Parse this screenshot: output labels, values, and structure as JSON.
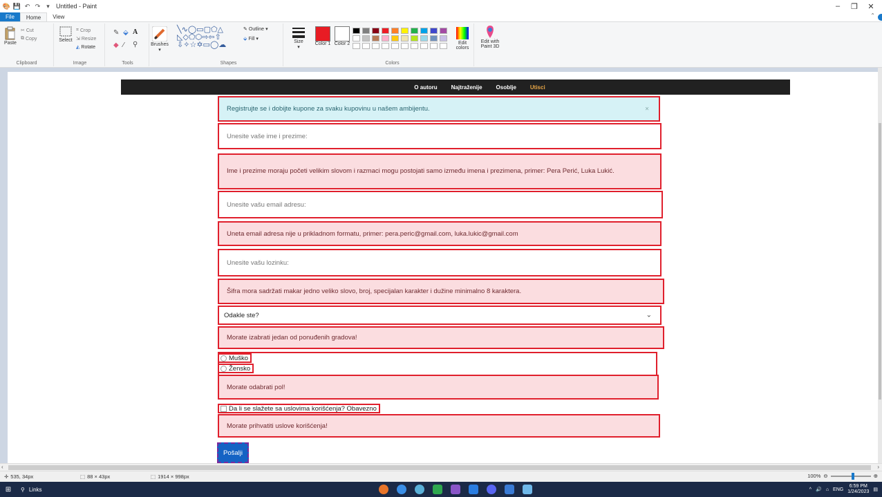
{
  "window": {
    "title": "Untitled - Paint",
    "controls": [
      "–",
      "❐",
      "✕"
    ]
  },
  "tabs": {
    "file": "File",
    "home": "Home",
    "view": "View"
  },
  "ribbon": {
    "clipboard": {
      "paste": "Paste",
      "cut": "Cut",
      "copy": "Copy",
      "label": "Clipboard"
    },
    "image": {
      "select": "Select",
      "crop": "Crop",
      "resize": "Resize",
      "rotate": "Rotate",
      "label": "Image"
    },
    "tools": {
      "label": "Tools"
    },
    "brushes": {
      "label": "Brushes"
    },
    "shapes": {
      "outline": "Outline",
      "fill": "Fill",
      "label": "Shapes"
    },
    "size": {
      "label": "Size"
    },
    "colors": {
      "color1": "Color 1",
      "color2": "Color 2",
      "edit_colors": "Edit colors",
      "edit_paint3d": "Edit with Paint 3D",
      "label": "Colors",
      "color1_value": "#e81c24",
      "color2_value": "#ffffff",
      "palette_row1": [
        "#000000",
        "#7f7f7f",
        "#880015",
        "#ed1c24",
        "#ff7f27",
        "#fff200",
        "#22b14c",
        "#00a2e8",
        "#3f48cc",
        "#a349a4"
      ],
      "palette_row2": [
        "#ffffff",
        "#c3c3c3",
        "#b97a57",
        "#ffaec9",
        "#ffc90e",
        "#efe4b0",
        "#b5e61d",
        "#99d9ea",
        "#7092be",
        "#c8bfe7"
      ],
      "palette_row3": [
        "#ffffff",
        "#ffffff",
        "#ffffff",
        "#ffffff",
        "#ffffff",
        "#ffffff",
        "#ffffff",
        "#ffffff",
        "#ffffff",
        "#ffffff"
      ]
    }
  },
  "page": {
    "nav": [
      "O autoru",
      "Najtraženije",
      "Osoblje",
      "Utisci"
    ],
    "info_alert": "Registrujte se i dobijte kupone za svaku kupovinu u našem ambijentu.",
    "info_close": "×",
    "name_placeholder": "Unesite vaše ime i prezime:",
    "name_error": "Ime i prezime moraju početi velikim slovom i razmaci mogu postojati samo između imena i prezimena, primer: Pera Perić, Luka Lukić.",
    "email_placeholder": "Unesite vašu email adresu:",
    "email_error": "Uneta email adresa nije u prikladnom formatu, primer: pera.peric@gmail.com, luka.lukic@gmail.com",
    "password_placeholder": "Unesite vašu lozinku:",
    "password_error": "Šifra mora sadržati makar jedno veliko slovo, broj, specijalan karakter i dužine minimalno 8 karaktera.",
    "city_select": "Odakle ste?",
    "city_error": "Morate izabrati jedan od ponuđenih gradova!",
    "gender_male": "Muško",
    "gender_female": "Žensko",
    "gender_error": "Morate odabrati pol!",
    "terms_label": "Da li se slažete sa uslovima korišćenja? Obavezno",
    "terms_error": "Morate prihvatiti uslove korišćenja!",
    "submit": "Pošalji"
  },
  "status": {
    "cursor": "535, 34px",
    "selection": "88 × 43px",
    "image_size": "1914 × 998px",
    "zoom": "100%"
  },
  "taskbar": {
    "search": "Links",
    "lang": "ENG",
    "time": "6:59 PM",
    "date": "1/24/2023"
  }
}
